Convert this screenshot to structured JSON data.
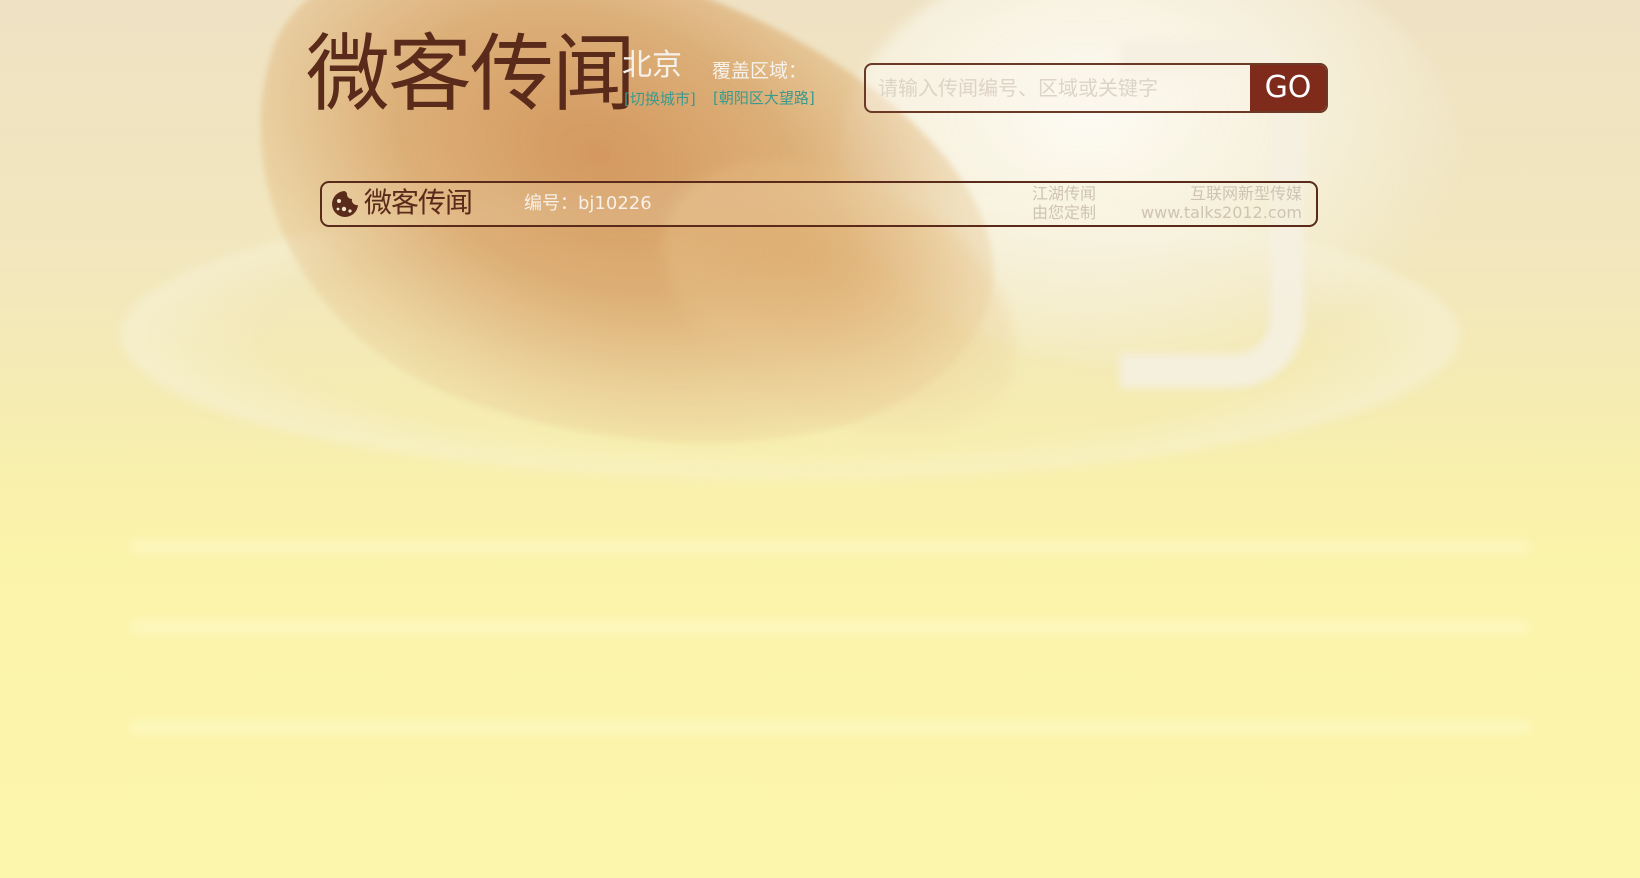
{
  "header": {
    "logo_text": "微客传闻",
    "city": "北京",
    "switch_city_link": "[切换城市]",
    "coverage_label": "覆盖区域：",
    "coverage_value": "[朝阳区大望路]"
  },
  "search": {
    "placeholder": "请输入传闻编号、区域或关键字",
    "value": "",
    "button_label": "GO"
  },
  "info_bar": {
    "logo_text": "微客传闻",
    "serial": "编号：bj10226",
    "slogan": {
      "line1_left": "江湖传闻",
      "line1_right": "互联网新型传媒",
      "line2_left": "由您定制",
      "line2_right": "www.talks2012.com"
    }
  },
  "colors": {
    "brand_brown": "#5a2b1a",
    "go_button": "#7e2b1c",
    "link_teal": "#3a9a8e",
    "background_yellow": "#fbf3b0"
  },
  "icons": {
    "mini_logo": "cookie-icon"
  }
}
